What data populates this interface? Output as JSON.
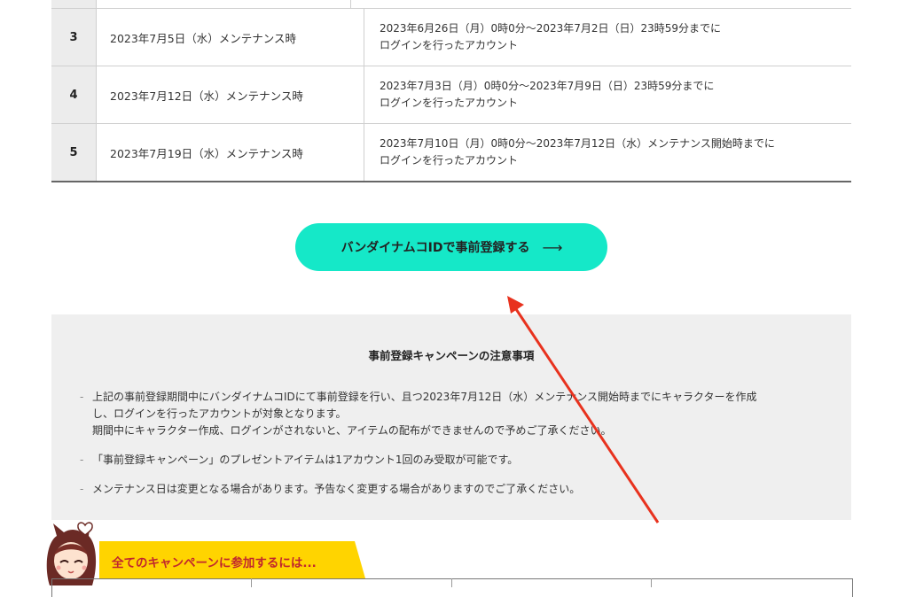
{
  "schedule": {
    "rows": [
      {
        "num": "",
        "date": "",
        "cond1": "",
        "cond2": ""
      },
      {
        "num": "3",
        "date": "2023年7月5日（水）メンテナンス時",
        "cond1": "2023年6月26日（月）0時0分～2023年7月2日（日）23時59分までに",
        "cond2": "ログインを行ったアカウント"
      },
      {
        "num": "4",
        "date": "2023年7月12日（水）メンテナンス時",
        "cond1": "2023年7月3日（月）0時0分～2023年7月9日（日）23時59分までに",
        "cond2": "ログインを行ったアカウント"
      },
      {
        "num": "5",
        "date": "2023年7月19日（水）メンテナンス時",
        "cond1": "2023年7月10日（月）0時0分～2023年7月12日（水）メンテナンス開始時までに",
        "cond2": "ログインを行ったアカウント"
      }
    ]
  },
  "cta": {
    "label": "バンダイナムコIDで事前登録する",
    "arrow": "⟶"
  },
  "notes": {
    "title": "事前登録キャンペーンの注意事項",
    "items": [
      {
        "lines": [
          "上記の事前登録期間中にバンダイナムコIDにて事前登録を行い、且つ2023年7月12日（水）メンテナンス開始時までにキャラクターを作成",
          "し、ログインを行ったアカウントが対象となります。",
          "期間中にキャラクター作成、ログインがされないと、アイテムの配布ができませんので予めご了承ください。"
        ]
      },
      {
        "lines": [
          "「事前登録キャンペーン」のプレゼントアイテムは1アカウント1回のみ受取が可能です。"
        ]
      },
      {
        "lines": [
          "メンテナンス日は変更となる場合があります。予告なく変更する場合がありますのでご了承ください。"
        ]
      }
    ]
  },
  "section": {
    "title": "全てのキャンペーンに参加するには..."
  },
  "colors": {
    "cta": "#15e8c8",
    "tab": "#ffd400",
    "section_title": "#c1272d",
    "annotation_arrow": "#e8321e"
  },
  "icons": {
    "mascot": "mascot-character-icon",
    "annotation": "red-annotation-arrow-icon"
  }
}
